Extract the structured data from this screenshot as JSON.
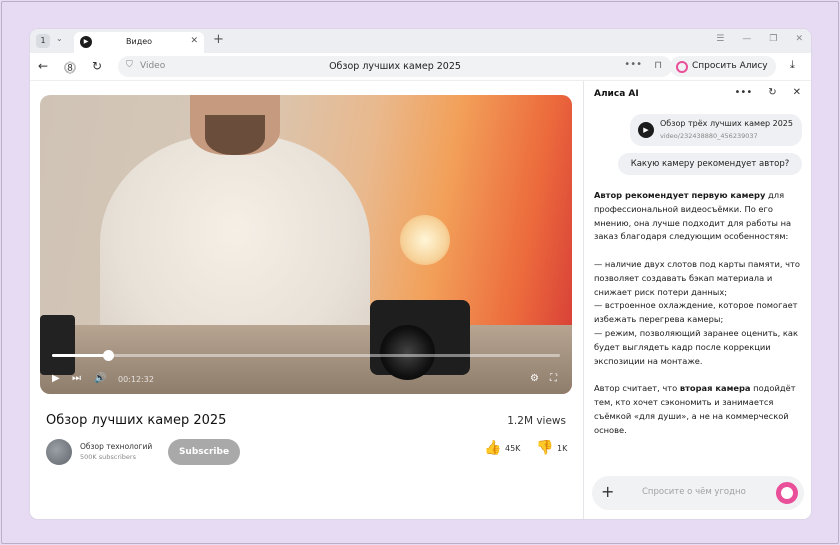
{
  "browser": {
    "tab_count": "1",
    "tab_title": "Видео",
    "address_site": "Video",
    "address_title": "Обзор лучших камер 2025",
    "alice_button": "Спросить Алису AI"
  },
  "video": {
    "title": "Обзор лучших камер 2025",
    "views": "1.2M views",
    "time": "00:12:32",
    "progress_percent": 11,
    "channel_name": "Обзор технологий",
    "channel_subs": "500K subscribers",
    "subscribe_label": "Subscribe",
    "likes": "45K",
    "dislikes": "1K"
  },
  "alice": {
    "title": "Алиса AI",
    "chip_title": "Обзор трёх лучших камер 2025",
    "chip_url": "video/232438880_456239037",
    "user_question": "Какую камеру рекомендует автор?",
    "answer_p1_bold": "Автор рекомендует первую камеру",
    "answer_p1_rest": " для профессиональной видеосъёмки. По его мнению, она лучше подходит для работы на заказ благодаря следующим особенностям:",
    "answer_list_1": "— наличие двух слотов под карты памяти, что позволяет создавать бэкап материала и снижает риск потери данных;",
    "answer_list_2": "— встроенное охлаждение, которое помогает избежать перегрева камеры;",
    "answer_list_3": "— режим, позволяющий заранее оценить, как будет выглядеть кадр после коррекции экспозиции на монтаже.",
    "answer_p3_start": "Автор считает, что ",
    "answer_p3_bold": "вторая камера",
    "answer_p3_rest": " подойдёт тем, кто хочет сэкономить и занимается съёмкой «для души», а не на коммерческой основе.",
    "composer_placeholder": "Спросите о чём угодно"
  },
  "colors": {
    "accent_pink": "#ea4f99",
    "page_bg": "#e6dbf3"
  }
}
